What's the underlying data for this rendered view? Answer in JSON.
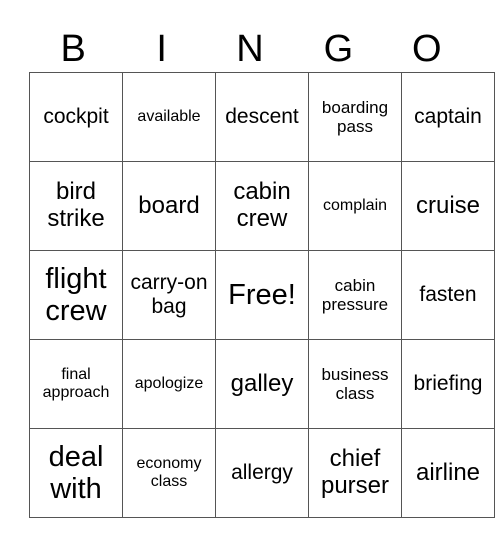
{
  "header": [
    "B",
    "I",
    "N",
    "G",
    "O"
  ],
  "rows": [
    [
      {
        "t": "cockpit",
        "s": "s3"
      },
      {
        "t": "available",
        "s": "s5"
      },
      {
        "t": "descent",
        "s": "s3"
      },
      {
        "t": "boarding pass",
        "s": "s4"
      },
      {
        "t": "captain",
        "s": "s3"
      }
    ],
    [
      {
        "t": "bird strike",
        "s": "s2"
      },
      {
        "t": "board",
        "s": "s2"
      },
      {
        "t": "cabin crew",
        "s": "s2"
      },
      {
        "t": "complain",
        "s": "s5"
      },
      {
        "t": "cruise",
        "s": "s2"
      }
    ],
    [
      {
        "t": "flight crew",
        "s": "s1"
      },
      {
        "t": "carry-on bag",
        "s": "s3"
      },
      {
        "t": "Free!",
        "s": "s1"
      },
      {
        "t": "cabin pressure",
        "s": "s4"
      },
      {
        "t": "fasten",
        "s": "s3"
      }
    ],
    [
      {
        "t": "final approach",
        "s": "s5"
      },
      {
        "t": "apologize",
        "s": "s5"
      },
      {
        "t": "galley",
        "s": "s2"
      },
      {
        "t": "business class",
        "s": "s4"
      },
      {
        "t": "briefing",
        "s": "s3"
      }
    ],
    [
      {
        "t": "deal with",
        "s": "s1"
      },
      {
        "t": "economy class",
        "s": "s5"
      },
      {
        "t": "allergy",
        "s": "s3"
      },
      {
        "t": "chief purser",
        "s": "s2"
      },
      {
        "t": "airline",
        "s": "s2"
      }
    ]
  ]
}
